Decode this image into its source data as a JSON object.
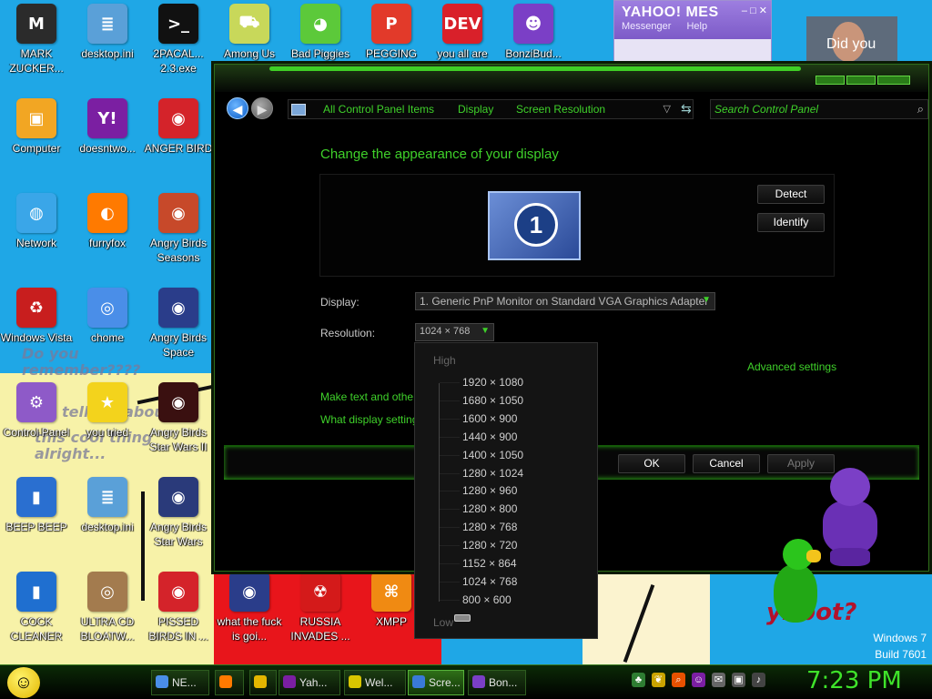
{
  "desktop": {
    "icons": [
      {
        "label": "MARK ZUCKER...",
        "color": "#2b2b2b",
        "glyph": "M"
      },
      {
        "label": "desktop.ini",
        "color": "#5aa0d8",
        "glyph": "≣"
      },
      {
        "label": "2PACAL... 2.3.exe",
        "color": "#111111",
        "glyph": ">_"
      },
      {
        "label": "Among Us",
        "color": "#c8d85a",
        "glyph": "⛟"
      },
      {
        "label": "Bad Piggies",
        "color": "#5cc93a",
        "glyph": "◕"
      },
      {
        "label": "PEGGING",
        "color": "#e23a2a",
        "glyph": "P"
      },
      {
        "label": "you all are",
        "color": "#d9202a",
        "glyph": "DEV"
      },
      {
        "label": "BonziBud...",
        "color": "#7b3fc6",
        "glyph": "☻"
      },
      {
        "label": "Computer",
        "color": "#f2a623",
        "glyph": "▣"
      },
      {
        "label": "doesntwo...",
        "color": "#7b1fa2",
        "glyph": "Y!"
      },
      {
        "label": "ANGER BIRD",
        "color": "#d4232a",
        "glyph": "◉"
      },
      {
        "label": "Network",
        "color": "#3aa6e8",
        "glyph": "◍"
      },
      {
        "label": "furryfox",
        "color": "#ff7a00",
        "glyph": "◐"
      },
      {
        "label": "Angry Birds Seasons",
        "color": "#c7492a",
        "glyph": "◉"
      },
      {
        "label": "Windows Vista",
        "color": "#c81e1e",
        "glyph": "♻"
      },
      {
        "label": "chome",
        "color": "#4a8ee8",
        "glyph": "◎"
      },
      {
        "label": "Angry Birds Space",
        "color": "#2a3d8a",
        "glyph": "◉"
      },
      {
        "label": "Control Panel",
        "color": "#8e5ac8",
        "glyph": "⚙"
      },
      {
        "label": "you tried",
        "color": "#f3d31c",
        "glyph": "★"
      },
      {
        "label": "Angry Birds Star Wars II",
        "color": "#3a1010",
        "glyph": "◉"
      },
      {
        "label": "BEEP BEEP",
        "color": "#2a6fd0",
        "glyph": "▮"
      },
      {
        "label": "desktop.ini",
        "color": "#5aa0d8",
        "glyph": "≣"
      },
      {
        "label": "Angry Birds Star Wars",
        "color": "#2a3a7a",
        "glyph": "◉"
      },
      {
        "label": "COCK CLEANER",
        "color": "#1f6fd0",
        "glyph": "▮"
      },
      {
        "label": "ULTRA CD BLOATW...",
        "color": "#a37b4e",
        "glyph": "◎"
      },
      {
        "label": "PISSED BIRDS IN ...",
        "color": "#d4232a",
        "glyph": "◉"
      },
      {
        "label": "what the fuck is goi...",
        "color": "#2a3d8a",
        "glyph": "◉"
      },
      {
        "label": "RUSSIA INVADES ...",
        "color": "#d41a1a",
        "glyph": "☢"
      },
      {
        "label": "XMPP",
        "color": "#f08a12",
        "glyph": "⌘"
      }
    ]
  },
  "wallpaper": {
    "text1": "Do you remember????",
    "text2": "tell me about",
    "text3": "this cool thing alright...",
    "ynbot": "ynbot?",
    "watermark_os": "Windows 7",
    "watermark_build": "Build 7601"
  },
  "yahoo": {
    "brand": "YAHOO! MES",
    "menu1": "Messenger",
    "menu2": "Help",
    "controls": "– □ ✕",
    "popup_text": "Did you"
  },
  "window": {
    "breadcrumb": [
      "All Control Panel Items",
      "Display",
      "Screen Resolution"
    ],
    "search_placeholder": "Search Control Panel",
    "heading": "Change the appearance of your display",
    "monitor_number": "1",
    "detect": "Detect",
    "identify": "Identify",
    "display_label": "Display:",
    "display_value": "1. Generic PnP Monitor on Standard VGA Graphics Adapter",
    "resolution_label": "Resolution:",
    "resolution_value": "1024 × 768",
    "advanced_link": "Advanced settings",
    "link_text_size": "Make text and other",
    "link_display_settings": "What display setting",
    "ok": "OK",
    "cancel": "Cancel",
    "apply": "Apply"
  },
  "resolution_popup": {
    "high": "High",
    "low": "Low",
    "options": [
      "1920 × 1080",
      "1680 × 1050",
      "1600 × 900",
      "1440 × 900",
      "1400 × 1050",
      "1280 × 1024",
      "1280 × 960",
      "1280 × 800",
      "1280 × 768",
      "1280 × 720",
      "1152 × 864",
      "1024 × 768",
      "800 × 600"
    ],
    "selected": "1024 × 768"
  },
  "taskbar": {
    "items": [
      {
        "label": "NE...",
        "color": "#4a8ee8"
      },
      {
        "label": "",
        "color": "#ff7a00"
      },
      {
        "label": "",
        "color": "#e3b600"
      },
      {
        "label": "Yah...",
        "color": "#7b1fa2"
      },
      {
        "label": "Wel...",
        "color": "#d9c600"
      },
      {
        "label": "Scre...",
        "color": "#3a7ad8"
      },
      {
        "label": "Bon...",
        "color": "#7b3fc6"
      }
    ],
    "clock": "7:23 PM",
    "accent": "#3fe32a"
  }
}
